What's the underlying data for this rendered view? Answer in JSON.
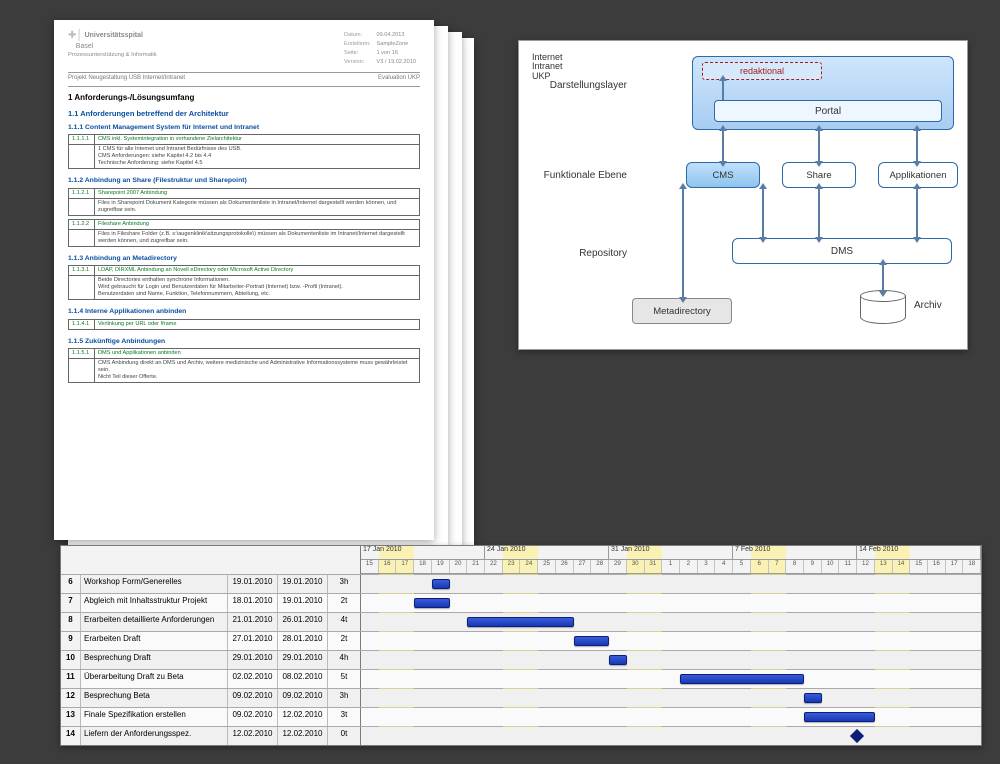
{
  "document": {
    "hospital_line1": "Universitätsspital",
    "hospital_line2": "Basel",
    "dept": "Prozessunterstützung & Informatik",
    "meta": {
      "datum_k": "Datum:",
      "datum_v": "09.04.2013",
      "erstellerin_k": "Erstellerin:",
      "erstellerin_v": "SampleZone",
      "seite_k": "Seite:",
      "seite_v": "1 von 16",
      "version_k": "Version:",
      "version_v": "V3 / 19.02.2010"
    },
    "project": "Projekt Neugestaltung USB Internet/Intranet",
    "eval": "Evaluation UKP",
    "h1": "1   Anforderungs-/Lösungsumfang",
    "h2": "1.1    Anforderungen betreffend der Architektur",
    "sections": [
      {
        "h3": "1.1.1   Content Management System für Internet und Intranet",
        "rows": [
          {
            "idx": "1.1.1.1",
            "title": "CMS inkl. Systemintegration in vorhandene Zielarchitektur",
            "body": "1 CMS für alle Internet und Intranet Bedürfnisse des USB.\nCMS Anforderungen: siehe Kapitel 4.2 bis 4.4\nTechnische Anforderung: siehe Kapitel 4.5"
          }
        ]
      },
      {
        "h3": "1.1.2   Anbindung an Share (Filestruktur und Sharepoint)",
        "rows": [
          {
            "idx": "1.1.2.1",
            "title": "Sharepoint 2007 Anbindung",
            "body": "Files in Sharepoint Dokument Kategorie müssen als Dokumentenliste in Intranet/Internet dargestellt werden können, und zugreifbar sein."
          },
          {
            "idx": "1.1.2.2",
            "title": "Fileshare Anbindung",
            "body": "Files in Fileshare Folder (z.B. s:\\augenklinik\\sitzungsprotokolle\\) müssen als Dokumentenliste im Intranet/Internet dargestellt werden können, und zugreifbar sein."
          }
        ]
      },
      {
        "h3": "1.1.3   Anbindung an Metadirectory",
        "rows": [
          {
            "idx": "1.1.3.1",
            "title": "LDAP, DIRXML Anbindung an Novell eDirectory oder Microsoft Active Directory",
            "body": "Beide Directories enthalten synchrone Informationen.\nWird gebraucht für Login und Benutzerdaten für Mitarbeiter-Portrait (Internet) bzw. -Profil (Intranet).\nBenutzerdaten sind Name, Funktion, Telefonnummern, Abteilung, etc."
          }
        ]
      },
      {
        "h3": "1.1.4   Interne Applikationen anbinden",
        "rows": [
          {
            "idx": "1.1.4.1",
            "title": "Verlinkung per URL oder Iframe",
            "body": ""
          }
        ]
      },
      {
        "h3": "1.1.5   Zukünftige Anbindungen",
        "rows": [
          {
            "idx": "1.1.5.1",
            "title": "DMS und Applikationen anbinden",
            "body": "CMS Anbindung direkt an DMS und Archiv, weitere medizinische und Administrative Informationssysteme muss gewährleistet sein.\nNicht Teil dieser Offerte."
          }
        ]
      }
    ]
  },
  "diagram": {
    "row_darstellung": "Darstellungslayer",
    "row_funktional": "Funktionale Ebene",
    "row_repository": "Repository",
    "internet": "Internet",
    "intranet": "Intranet\nUKP",
    "redaktional": "redaktional",
    "portal": "Portal",
    "cms": "CMS",
    "share": "Share",
    "apps": "Applikationen",
    "dms": "DMS",
    "metadirectory": "Metadirectory",
    "archiv": "Archiv"
  },
  "gantt": {
    "weeks": [
      "17 Jan 2010",
      "24 Jan 2010",
      "31 Jan 2010",
      "7 Feb 2010",
      "14 Feb 2010"
    ],
    "days": [
      "15",
      "16",
      "17",
      "18",
      "19",
      "20",
      "21",
      "22",
      "23",
      "24",
      "25",
      "26",
      "27",
      "28",
      "29",
      "30",
      "31",
      "1",
      "2",
      "3",
      "4",
      "5",
      "6",
      "7",
      "8",
      "9",
      "10",
      "11",
      "12",
      "13",
      "14",
      "15",
      "16",
      "17",
      "18"
    ],
    "tasks": [
      {
        "n": 6,
        "name": "Workshop Form/Generelles",
        "d1": "19.01.2010",
        "d2": "19.01.2010",
        "dur": "3h",
        "start": 4,
        "len": 1
      },
      {
        "n": 7,
        "name": "Abgleich mit Inhaltsstruktur Projekt",
        "d1": "18.01.2010",
        "d2": "19.01.2010",
        "dur": "2t",
        "start": 3,
        "len": 2
      },
      {
        "n": 8,
        "name": "Erarbeiten detaillierte Anforderungen",
        "d1": "21.01.2010",
        "d2": "26.01.2010",
        "dur": "4t",
        "start": 6,
        "len": 6
      },
      {
        "n": 9,
        "name": "Erarbeiten Draft",
        "d1": "27.01.2010",
        "d2": "28.01.2010",
        "dur": "2t",
        "start": 12,
        "len": 2
      },
      {
        "n": 10,
        "name": "Besprechung Draft",
        "d1": "29.01.2010",
        "d2": "29.01.2010",
        "dur": "4h",
        "start": 14,
        "len": 1
      },
      {
        "n": 11,
        "name": "Überarbeitung Draft zu Beta",
        "d1": "02.02.2010",
        "d2": "08.02.2010",
        "dur": "5t",
        "start": 18,
        "len": 7
      },
      {
        "n": 12,
        "name": "Besprechung Beta",
        "d1": "09.02.2010",
        "d2": "09.02.2010",
        "dur": "3h",
        "start": 25,
        "len": 1
      },
      {
        "n": 13,
        "name": "Finale Spezifikation erstellen",
        "d1": "09.02.2010",
        "d2": "12.02.2010",
        "dur": "3t",
        "start": 25,
        "len": 4
      },
      {
        "n": 14,
        "name": "Liefern der Anforderungsspez.",
        "d1": "12.02.2010",
        "d2": "12.02.2010",
        "dur": "0t",
        "start": 28,
        "len": 0
      }
    ],
    "weekend_cols": [
      [
        1,
        2
      ],
      [
        8,
        2
      ],
      [
        15,
        2
      ],
      [
        22,
        2
      ],
      [
        29,
        2
      ]
    ]
  }
}
